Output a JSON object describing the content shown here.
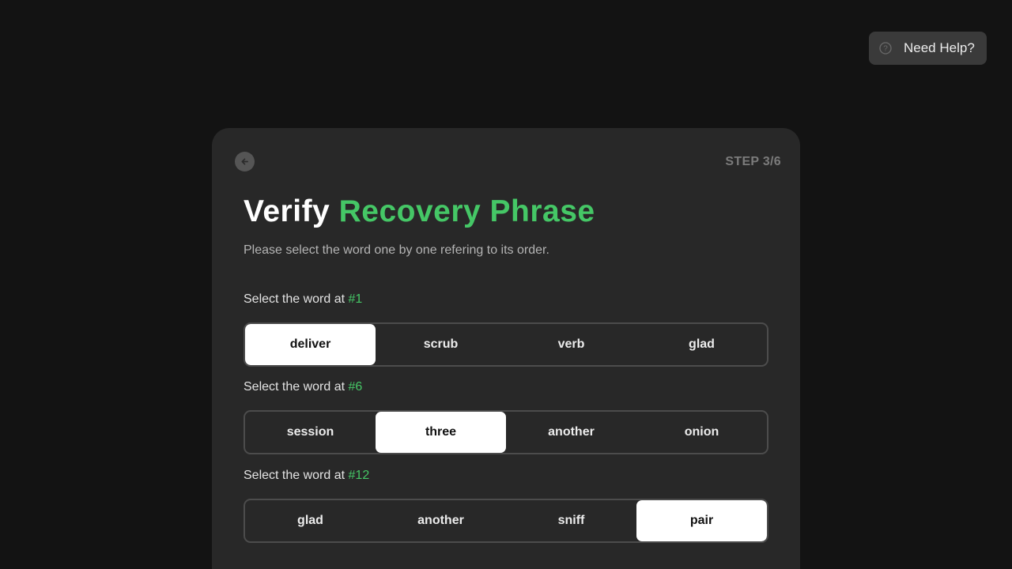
{
  "help": {
    "label": "Need Help?",
    "icon": "question-circle-icon"
  },
  "card": {
    "back_icon": "arrow-left-icon",
    "step": "STEP 3/6",
    "title_part1": "Verify",
    "title_part2": "Recovery Phrase",
    "subtitle": "Please select the word one by one refering to its order."
  },
  "questions": [
    {
      "prompt": "Select the word at",
      "number": "#1",
      "options": [
        "deliver",
        "scrub",
        "verb",
        "glad"
      ],
      "selected": "deliver"
    },
    {
      "prompt": "Select the word at",
      "number": "#6",
      "options": [
        "session",
        "three",
        "another",
        "onion"
      ],
      "selected": "three"
    },
    {
      "prompt": "Select the word at",
      "number": "#12",
      "options": [
        "glad",
        "another",
        "sniff",
        "pair"
      ],
      "selected": "pair"
    }
  ],
  "colors": {
    "background": "#131313",
    "card": "#282828",
    "accent_green": "#45c766",
    "selected_bg": "#ffffff"
  }
}
